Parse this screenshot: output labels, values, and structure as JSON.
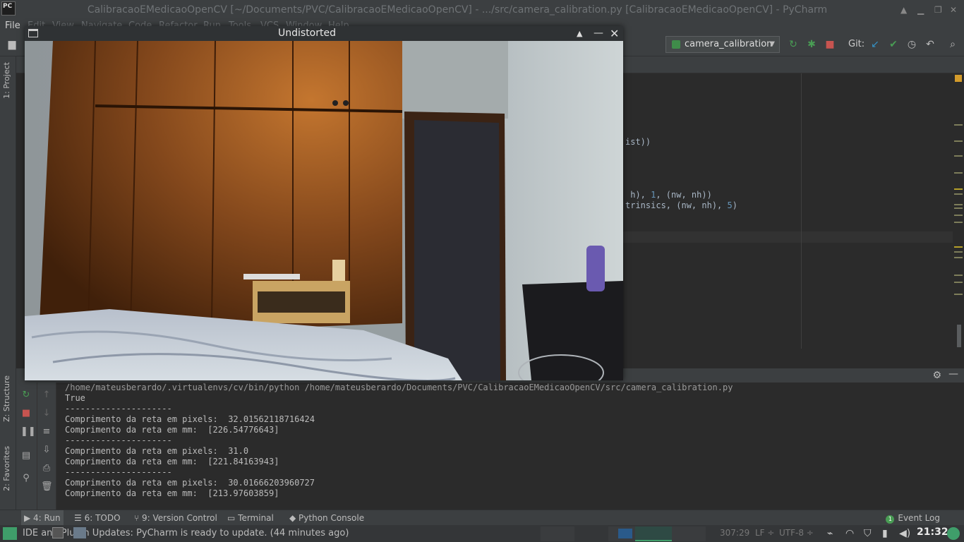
{
  "ide": {
    "window_title": "CalibracaoEMedicaoOpenCV [~/Documents/PVC/CalibracaoEMedicaoOpenCV] - .../src/camera_calibration.py [CalibracaoEMedicaoOpenCV] - PyCharm",
    "logo_text": "PC"
  },
  "menu": [
    "File",
    "Edit",
    "View",
    "Navigate",
    "Code",
    "Refactor",
    "Run",
    "Tools",
    "VCS",
    "Window",
    "Help"
  ],
  "navbar": {
    "run_config": "camera_calibration",
    "git_label": "Git:"
  },
  "side_tabs": {
    "project": "1: Project",
    "structure": "Z: Structure",
    "favorites": "2: Favorites"
  },
  "editor": {
    "line1": "ist))",
    "line2_a": " h), ",
    "line2_num": "1",
    "line2_b": ", (nw, nh))",
    "line3_a": "trinsics, (nw, nh), ",
    "line3_num": "5",
    "line3_b": ")"
  },
  "console": {
    "command": "/home/mateusberardo/.virtualenvs/cv/bin/python /home/mateusberardo/Documents/PVC/CalibracaoEMedicaoOpenCV/src/camera_calibration.py",
    "lines": [
      "True",
      "---------------------",
      "Comprimento da reta em pixels:  32.01562118716424",
      "Comprimento da reta em mm:  [226.54776643]",
      "---------------------",
      "Comprimento da reta em pixels:  31.0",
      "Comprimento da reta em mm:  [221.84163943]",
      "---------------------",
      "Comprimento da reta em pixels:  30.01666203960727",
      "Comprimento da reta em mm:  [213.97603859]"
    ]
  },
  "bottom_tabs": {
    "run": "4: Run",
    "todo": "6: TODO",
    "vcs": "9: Version Control",
    "terminal": "Terminal",
    "python_console": "Python Console",
    "event_log": "Event Log",
    "event_count": "1"
  },
  "status": {
    "message": "IDE and Plugin Updates: PyCharm is ready to update. (44 minutes ago)",
    "position": "307:29",
    "line_sep": "LF ÷",
    "encoding": "UTF-8 ÷",
    "clock": "21:32"
  },
  "cv_window": {
    "title": "Undistorted"
  },
  "colors": {
    "ide_bg": "#2b2b2b",
    "panel_bg": "#3c3f41",
    "run_green": "#499c54",
    "stop_red": "#c75450",
    "code_number": "#6897bb"
  }
}
